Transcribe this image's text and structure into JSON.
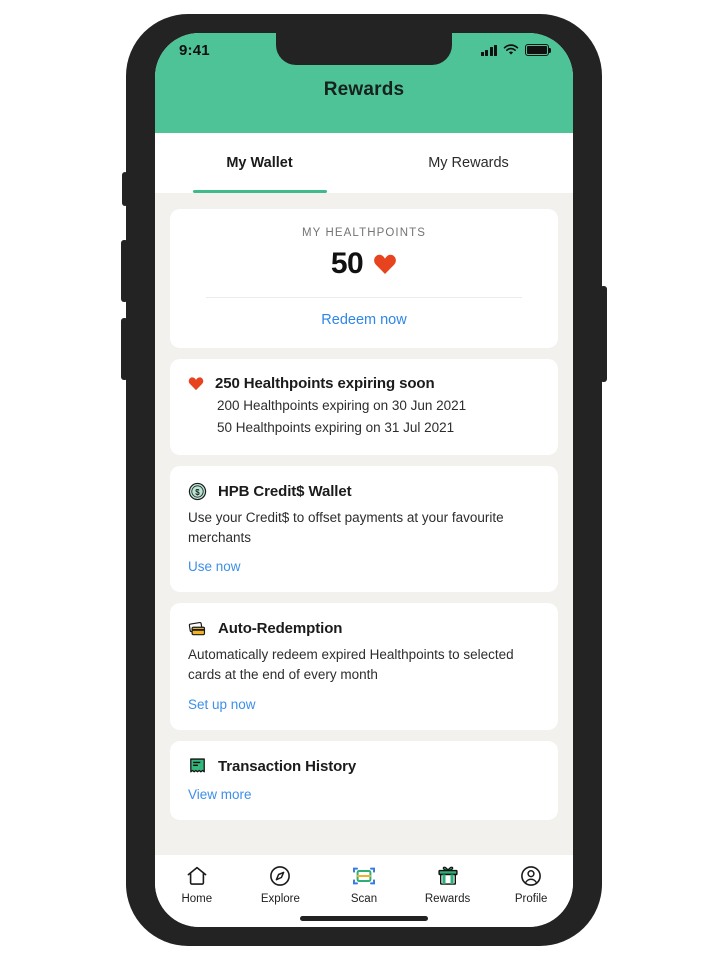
{
  "status_bar": {
    "time": "9:41",
    "signal_icon": "cellular-signal-icon",
    "wifi_icon": "wifi-icon",
    "battery_icon": "battery-full-icon"
  },
  "header": {
    "title": "Rewards",
    "background_color": "#4ec397"
  },
  "tabs": [
    {
      "label": "My Wallet",
      "active": true
    },
    {
      "label": "My Rewards",
      "active": false
    }
  ],
  "points_card": {
    "label": "MY HEALTHPOINTS",
    "value": "50",
    "heart_icon": "heart-icon",
    "heart_color": "#e8431f",
    "redeem_label": "Redeem now",
    "link_color": "#2f86e8"
  },
  "cards": [
    {
      "icon": "heart-icon",
      "title": "250 Healthpoints expiring soon",
      "lines": [
        "200 Healthpoints expiring on 30 Jun 2021",
        "50 Healthpoints expiring on 31 Jul 2021"
      ]
    },
    {
      "icon": "dollar-coin-icon",
      "title": "HPB Credit$ Wallet",
      "description": "Use your Credit$ to offset payments at your favourite merchants",
      "link": "Use now"
    },
    {
      "icon": "credit-cards-icon",
      "title": "Auto-Redemption",
      "description": "Automatically redeem expired Healthpoints to selected cards at the end of every month",
      "link": "Set up now"
    },
    {
      "icon": "receipt-icon",
      "title": "Transaction  History",
      "link": "View more"
    }
  ],
  "bottom_nav": [
    {
      "label": "Home",
      "icon": "home-icon"
    },
    {
      "label": "Explore",
      "icon": "compass-icon"
    },
    {
      "label": "Scan",
      "icon": "scan-qr-icon"
    },
    {
      "label": "Rewards",
      "icon": "gift-icon"
    },
    {
      "label": "Profile",
      "icon": "person-circle-icon"
    }
  ]
}
